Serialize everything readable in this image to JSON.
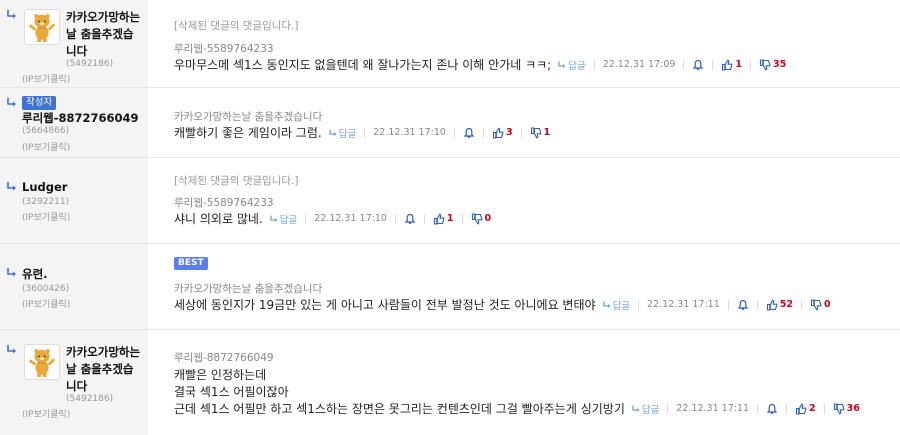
{
  "comments": [
    {
      "nickname_line1": "카카오가망하는",
      "nickname_line2": "날 춤을추겠습",
      "nickname_line3": "니다",
      "uid": "(5492186)",
      "ip_link": "(IP보기클릭)",
      "quote": "[삭제된 댓글의 댓글입니다.]",
      "target": "루리웹-5589764233",
      "text": "우마무스메 섹1스 동인지도 없을텐데 왜 잘나가는지 존나 이해 안가네 ㅋㅋ;",
      "reply_label": "답글",
      "date": "22.12.31 17:09",
      "up": "1",
      "down": "35"
    },
    {
      "author_badge": "작성자",
      "nickname_line1": "루리웹-8872766049",
      "uid": "(5664866)",
      "ip_link": "(IP보기클릭)",
      "target": "카카오가망하는날 춤을추겠습니다",
      "text": "캐빨하기 좋은 게임이라 그럼.",
      "reply_label": "답글",
      "date": "22.12.31 17:10",
      "up": "3",
      "down": "1"
    },
    {
      "nickname_line1": "Ludger",
      "uid": "(3292211)",
      "ip_link": "(IP보기클릭)",
      "quote": "[삭제된 댓글의 댓글입니다.]",
      "target": "루리웹-5589764233",
      "text": "샤니 의외로 많네.",
      "reply_label": "답글",
      "date": "22.12.31 17:10",
      "up": "1",
      "down": "0"
    },
    {
      "nickname_line1": "유련.",
      "uid": "(3600426)",
      "ip_link": "(IP보기클릭)",
      "best_badge": "BEST",
      "target": "카카오가망하는날 춤을추겠습니다",
      "text": "세상에 동인지가 19금만 있는 게 아니고 사람들이 전부 발정난 것도 아니에요 변태야",
      "reply_label": "답글",
      "date": "22.12.31 17:11",
      "up": "52",
      "down": "0"
    },
    {
      "nickname_line1": "카카오가망하는",
      "nickname_line2": "날 춤을추겠습",
      "nickname_line3": "니다",
      "uid": "(5492186)",
      "ip_link": "(IP보기클릭)",
      "target": "루리웹-8872766049",
      "text_line1": "캐빨은 인정하는데",
      "text_line2": "결국 섹1스 어필이잖아",
      "text_line3": "근데 섹1스 어필만 하고 섹1스하는 장면은 못그리는 컨텐츠인데 그걸 빨아주는게 싱기방기",
      "reply_label": "답글",
      "date": "22.12.31 17:11",
      "up": "2",
      "down": "36"
    }
  ],
  "icons": {
    "reply_arrow": "reply-arrow-icon",
    "report": "bell-icon",
    "thumbs_up": "thumbs-up-icon",
    "thumbs_down": "thumbs-down-icon",
    "avatar": "ryan-character-avatar"
  },
  "colors": {
    "accent_blue": "#3e73d6",
    "best_badge": "#5a7df0",
    "count_red": "#d0021b",
    "reply_link": "#6fa0e0"
  }
}
